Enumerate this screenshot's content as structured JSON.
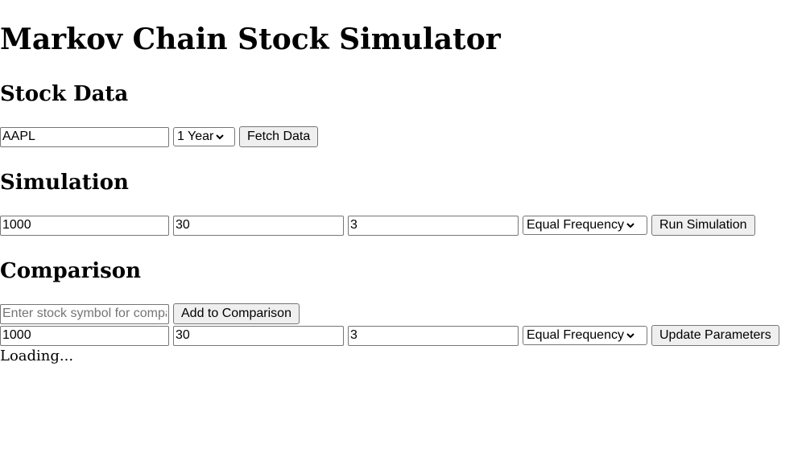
{
  "page_title": "Markov Chain Stock Simulator",
  "stock_data": {
    "heading": "Stock Data",
    "symbol_value": "AAPL",
    "period_selected": "1 Year",
    "fetch_button": "Fetch Data"
  },
  "simulation": {
    "heading": "Simulation",
    "num_simulations": "1000",
    "num_days": "30",
    "num_states": "3",
    "binning_method": "Equal Frequency",
    "run_button": "Run Simulation"
  },
  "comparison": {
    "heading": "Comparison",
    "symbol_placeholder": "Enter stock symbol for comparison",
    "add_button": "Add to Comparison",
    "num_simulations": "1000",
    "num_days": "30",
    "num_states": "3",
    "binning_method": "Equal Frequency",
    "update_button": "Update Parameters"
  },
  "status": {
    "loading_text": "Loading..."
  },
  "icons": {
    "select_chevron": "chevron-down-icon"
  }
}
